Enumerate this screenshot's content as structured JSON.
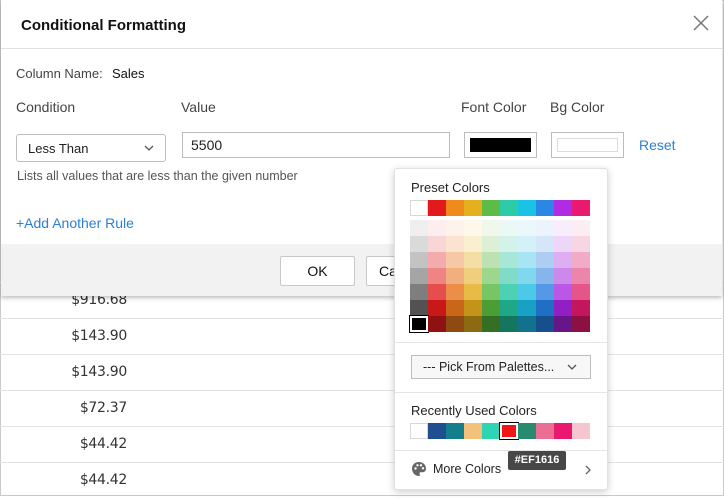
{
  "dialog": {
    "title": "Conditional Formatting",
    "column_name_label": "Column Name:",
    "column_name_value": "Sales",
    "headers": {
      "condition": "Condition",
      "value": "Value",
      "font_color": "Font Color",
      "bg_color": "Bg Color"
    },
    "condition_selected": "Less Than",
    "value_input": "5500",
    "font_color": "#000000",
    "bg_color": "#ffffff",
    "reset_label": "Reset",
    "hint": "Lists all values that are less than the given number",
    "add_rule_label": "+Add Another Rule",
    "ok_label": "OK",
    "cancel_label_visible": "Ca"
  },
  "table": {
    "values": [
      "$916.68",
      "$143.90",
      "$143.90",
      "$72.37",
      "$44.42",
      "$44.42"
    ]
  },
  "color_picker": {
    "preset_title": "Preset Colors",
    "preset_rows": [
      [
        "#FFFFFF",
        "#E31A1C",
        "#F08A1A",
        "#E4B01E",
        "#5DBB47",
        "#2DCCA8",
        "#1AC2E3",
        "#2B86E4",
        "#B02BE4",
        "#E8196E"
      ],
      [
        "#EFEFEF",
        "#FCEEEE",
        "#FDF3EB",
        "#FDF8EA",
        "#F0F8EC",
        "#EAF9F5",
        "#EAF8FC",
        "#ECF3FC",
        "#F7EDFC",
        "#FCEDF3"
      ],
      [
        "#DADADA",
        "#F9D6D6",
        "#FBE3D0",
        "#FAEFCF",
        "#DDF0D6",
        "#D2F2EA",
        "#D2F1F9",
        "#D5E6F8",
        "#EED6F8",
        "#F8D5E3"
      ],
      [
        "#C3C3C3",
        "#F4ABAB",
        "#F7C8A5",
        "#F4DEA3",
        "#BDE2B1",
        "#A7E7D8",
        "#A7E4F4",
        "#ADCDF2",
        "#DDAEF2",
        "#F2ABC6"
      ],
      [
        "#A5A5A5",
        "#EF8484",
        "#F2AF7E",
        "#EFCF7D",
        "#9FD68E",
        "#80DCC8",
        "#7FD8EE",
        "#86B5EC",
        "#CD88EC",
        "#EC85AA"
      ],
      [
        "#7E7E7E",
        "#E64D4D",
        "#EB8F48",
        "#E7BB46",
        "#78C563",
        "#4DD1B3",
        "#4CC9E8",
        "#5599E6",
        "#BB57E6",
        "#E6558A"
      ],
      [
        "#525252",
        "#C91818",
        "#C9661A",
        "#C49418",
        "#4B9E36",
        "#1FA887",
        "#17A1C4",
        "#1F6FC4",
        "#911FC4",
        "#C4165C"
      ],
      [
        "#000000",
        "#8F1111",
        "#8F4A12",
        "#8C6A12",
        "#356F26",
        "#157660",
        "#10728C",
        "#154F8C",
        "#661689",
        "#8C1042"
      ]
    ],
    "palette_select_label": "--- Pick From Palettes...",
    "recent_title": "Recently Used Colors",
    "recent_colors": [
      "#FFFFFF",
      "#1F4F8F",
      "#137F8C",
      "#F2C27C",
      "#2FD4B4",
      "#EF1616",
      "#2A8A6E",
      "#EB6F92",
      "#E8196E",
      "#F5C6CF"
    ],
    "more_colors_label": "More Colors",
    "tooltip": "#EF1616"
  },
  "icons": {
    "close": "close-icon",
    "chevron": "chevron-down-icon",
    "palette": "palette-icon",
    "more_chevron": "chevron-right-icon"
  }
}
